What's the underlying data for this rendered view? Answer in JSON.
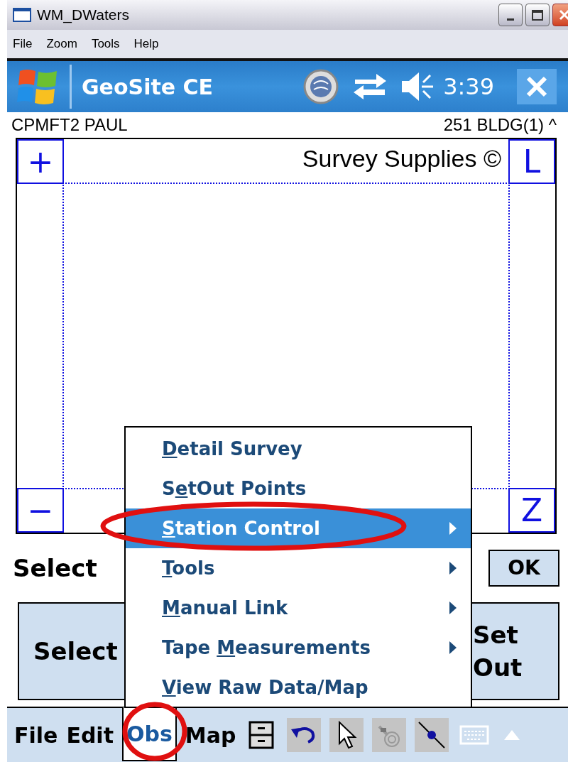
{
  "window": {
    "title": "WM_DWaters"
  },
  "menu_bar": [
    "File",
    "Zoom",
    "Tools",
    "Help"
  ],
  "header": {
    "title": "GeoSite CE",
    "time": "3:39"
  },
  "status": {
    "left": "CPMFT2 PAUL",
    "right": "251 BLDG(1) ^"
  },
  "map": {
    "caption": "Survey Supplies ©",
    "corners": [
      "+",
      "L",
      "−",
      "Z"
    ]
  },
  "select_label": "Select",
  "ok_button": "OK",
  "action_buttons": [
    "Select",
    "Set Out"
  ],
  "popup_menu": {
    "items": [
      {
        "key": "D",
        "post": "etail Survey",
        "submenu": false,
        "selected": false
      },
      {
        "pre": "S",
        "key": "e",
        "post": "tOut Points",
        "submenu": false,
        "selected": false
      },
      {
        "key": "S",
        "post": "tation Control",
        "submenu": true,
        "selected": true
      },
      {
        "key": "T",
        "post": "ools",
        "submenu": true,
        "selected": false
      },
      {
        "key": "M",
        "post": "anual Link",
        "submenu": true,
        "selected": false
      },
      {
        "pre": "Tape ",
        "key": "M",
        "post": "easurements",
        "submenu": true,
        "selected": false
      },
      {
        "key": "V",
        "post": "iew Raw Data/Map",
        "submenu": false,
        "selected": false
      }
    ]
  },
  "bottom_bar": {
    "menus": [
      {
        "label": "File",
        "selected": false
      },
      {
        "label": "Edit",
        "selected": false
      },
      {
        "label": "Obs",
        "selected": true
      },
      {
        "label": "Map",
        "selected": false
      }
    ]
  }
}
